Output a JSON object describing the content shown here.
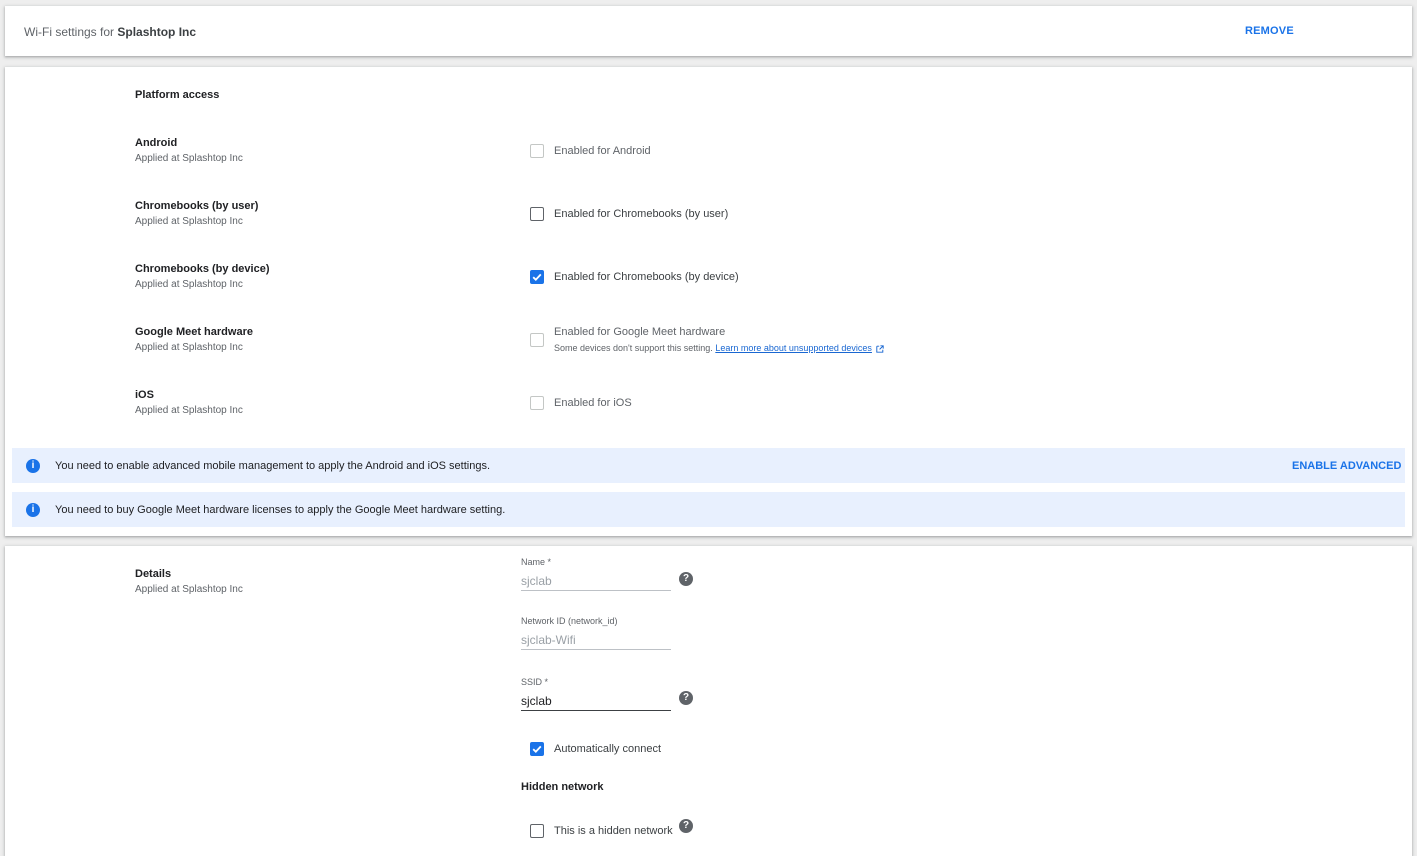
{
  "header": {
    "title_prefix": "Wi-Fi settings for",
    "org_name": "Splashtop Inc",
    "remove_label": "REMOVE"
  },
  "platform": {
    "title": "Platform access",
    "rows": [
      {
        "name": "Android",
        "applied": "Applied at Splashtop Inc",
        "checkbox_label": "Enabled for Android",
        "checked": false,
        "disabled": true
      },
      {
        "name": "Chromebooks (by user)",
        "applied": "Applied at Splashtop Inc",
        "checkbox_label": "Enabled for Chromebooks (by user)",
        "checked": false,
        "disabled": false
      },
      {
        "name": "Chromebooks (by device)",
        "applied": "Applied at Splashtop Inc",
        "checkbox_label": "Enabled for Chromebooks (by device)",
        "checked": true,
        "disabled": false
      },
      {
        "name": "Google Meet hardware",
        "applied": "Applied at Splashtop Inc",
        "checkbox_label": "Enabled for Google Meet hardware",
        "checked": false,
        "disabled": true,
        "note": "Some devices don't support this setting.",
        "link": "Learn more about unsupported devices"
      },
      {
        "name": "iOS",
        "applied": "Applied at Splashtop Inc",
        "checkbox_label": "Enabled for iOS",
        "checked": false,
        "disabled": true
      }
    ],
    "banners": [
      {
        "message": "You need to enable advanced mobile management to apply the Android and iOS settings.",
        "action": "ENABLE ADVANCED"
      },
      {
        "message": "You need to buy Google Meet hardware licenses to apply the Google Meet hardware setting."
      }
    ]
  },
  "details": {
    "title": "Details",
    "applied": "Applied at Splashtop Inc",
    "name_label": "Name *",
    "name_value": "sjclab",
    "network_id_label": "Network ID (network_id)",
    "network_id_value": "sjclab-Wifi",
    "ssid_label": "SSID *",
    "ssid_value": "sjclab",
    "auto_connect_label": "Automatically connect",
    "auto_connect_checked": true,
    "hidden_network_heading": "Hidden network",
    "hidden_network_label": "This is a hidden network",
    "hidden_network_checked": false
  },
  "colors": {
    "accent": "#1a73e8",
    "banner_bg": "#e8f0fe",
    "page_bg": "#eeeeee"
  }
}
